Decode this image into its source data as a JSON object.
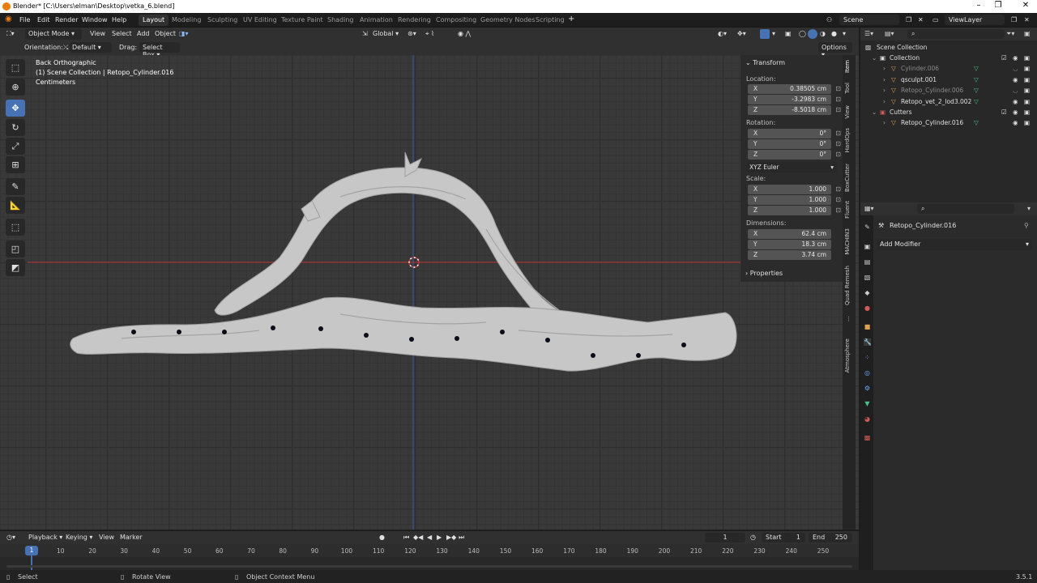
{
  "window": {
    "title": "Blender* [C:\\Users\\elman\\Desktop\\vetka_6.blend]",
    "minimize": "–",
    "maximize": "❐",
    "close": "✕"
  },
  "menu": {
    "items": [
      "File",
      "Edit",
      "Render",
      "Window",
      "Help"
    ]
  },
  "workspaces": {
    "tabs": [
      "Layout",
      "Modeling",
      "Sculpting",
      "UV Editing",
      "Texture Paint",
      "Shading",
      "Animation",
      "Rendering",
      "Compositing",
      "Geometry Nodes",
      "Scripting"
    ],
    "active": "Layout",
    "add": "+"
  },
  "scene": {
    "label": "Scene",
    "view_layer": "ViewLayer"
  },
  "viewport_header": {
    "mode": "Object Mode",
    "view": "View",
    "select": "Select",
    "add": "Add",
    "object": "Object",
    "transform_orientation": "Global"
  },
  "tool_header": {
    "orientation_label": "Orientation:",
    "orientation_value": "Default",
    "drag_label": "Drag:",
    "drag_value": "Select Box",
    "options": "Options"
  },
  "viewport_info": {
    "view": "Back Orthographic",
    "collection": "(1) Scene Collection | Retopo_Cylinder.016",
    "units": "Centimeters"
  },
  "npanel": {
    "transform_title": "Transform",
    "location_label": "Location:",
    "location": [
      {
        "axis": "X",
        "value": "0.38505 cm"
      },
      {
        "axis": "Y",
        "value": "-3.2983 cm"
      },
      {
        "axis": "Z",
        "value": "-8.5018 cm"
      }
    ],
    "rotation_label": "Rotation:",
    "rotation": [
      {
        "axis": "X",
        "value": "0°"
      },
      {
        "axis": "Y",
        "value": "0°"
      },
      {
        "axis": "Z",
        "value": "0°"
      }
    ],
    "rotation_mode": "XYZ Euler",
    "scale_label": "Scale:",
    "scale": [
      {
        "axis": "X",
        "value": "1.000"
      },
      {
        "axis": "Y",
        "value": "1.000"
      },
      {
        "axis": "Z",
        "value": "1.000"
      }
    ],
    "dimensions_label": "Dimensions:",
    "dimensions": [
      {
        "axis": "X",
        "value": "62.4 cm"
      },
      {
        "axis": "Y",
        "value": "18.3 cm"
      },
      {
        "axis": "Z",
        "value": "3.74 cm"
      }
    ],
    "properties_label": "Properties",
    "tabs": [
      "Item",
      "Tool",
      "View",
      "HardOps",
      "BoxCutter",
      "Fluent",
      "MACHIN3",
      "Quad Remesh",
      "Atmosphere"
    ]
  },
  "outliner": {
    "root": "Scene Collection",
    "rows": [
      {
        "name": "Collection",
        "type": "collection",
        "indent": 0
      },
      {
        "name": "Cylinder.006",
        "type": "mesh",
        "indent": 1,
        "dim": true
      },
      {
        "name": "qsculpt.001",
        "type": "mesh",
        "indent": 1,
        "dim": false
      },
      {
        "name": "Retopo_Cylinder.006",
        "type": "mesh",
        "indent": 1,
        "dim": true
      },
      {
        "name": "Retopo_vet_2_lod3.002",
        "type": "mesh",
        "indent": 1,
        "dim": false
      },
      {
        "name": "Cutters",
        "type": "collection",
        "indent": 0
      },
      {
        "name": "Retopo_Cylinder.016",
        "type": "mesh",
        "indent": 1,
        "dim": false
      }
    ]
  },
  "properties": {
    "object_name": "Retopo_Cylinder.016",
    "add_modifier": "Add Modifier"
  },
  "timeline_header": {
    "playback": "Playback",
    "keying": "Keying",
    "view": "View",
    "marker": "Marker",
    "current_frame": "1",
    "start_label": "Start",
    "start": "1",
    "end_label": "End",
    "end": "250"
  },
  "timeline": {
    "current": "1",
    "ticks": [
      "10",
      "20",
      "30",
      "40",
      "50",
      "60",
      "70",
      "80",
      "90",
      "100",
      "110",
      "120",
      "130",
      "140",
      "150",
      "160",
      "170",
      "180",
      "190",
      "200",
      "210",
      "220",
      "230",
      "240",
      "250"
    ]
  },
  "statusbar": {
    "select": "Select",
    "rotate": "Rotate View",
    "context": "Object Context Menu",
    "version": "3.5.1"
  },
  "colors": {
    "accent": "#4772b3",
    "x_axis": "#c43a3a",
    "z_axis": "#3a55a8",
    "mesh": "#c7c7c7",
    "mesh_icon": "#e0a050",
    "vgroup": "#44c38d"
  }
}
